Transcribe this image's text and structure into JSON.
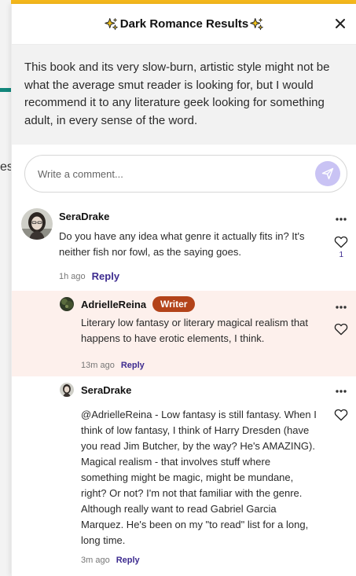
{
  "background": {
    "fragment": "es"
  },
  "header": {
    "title": "Dark Romance Results",
    "icon": "sparkles-icon"
  },
  "excerpt": {
    "text": "This book and its very slow-burn, artistic style might not be what the average smut reader is looking for, but I would recommend it to any literature geek looking for something adult, in every sense of the word."
  },
  "comment_input": {
    "placeholder": "Write a comment..."
  },
  "comments": [
    {
      "author": "SeraDrake",
      "text": "Do you have any idea what genre it actually fits in? It's neither fish nor fowl, as the saying goes.",
      "time": "1h ago",
      "reply_label": "Reply",
      "likes": "1"
    },
    {
      "author": "AdrielleReina",
      "badge": "Writer",
      "text": "Literary low fantasy or literary magical realism that happens to have erotic elements, I think.",
      "time": "13m ago",
      "reply_label": "Reply"
    },
    {
      "author": "SeraDrake",
      "text": "@AdrielleReina - Low fantasy is still fantasy. When I think of low fantasy, I think of Harry Dresden (have you read Jim Butcher, by the way? He's AMAZING). Magical realism - that involves stuff where something might be magic, might be mundane, right? Or not? I'm not that familiar with the genre. Although really want to read Gabriel Garcia Marquez. He's been on my \"to read\" list for a long, long time.",
      "time": "3m ago",
      "reply_label": "Reply"
    }
  ],
  "colors": {
    "accent": "#3d2b8f",
    "badge": "#b3431a",
    "highlight_row": "#fdf0ec",
    "send_button": "#c9c3f4",
    "top_bar": "#f5b81c"
  }
}
